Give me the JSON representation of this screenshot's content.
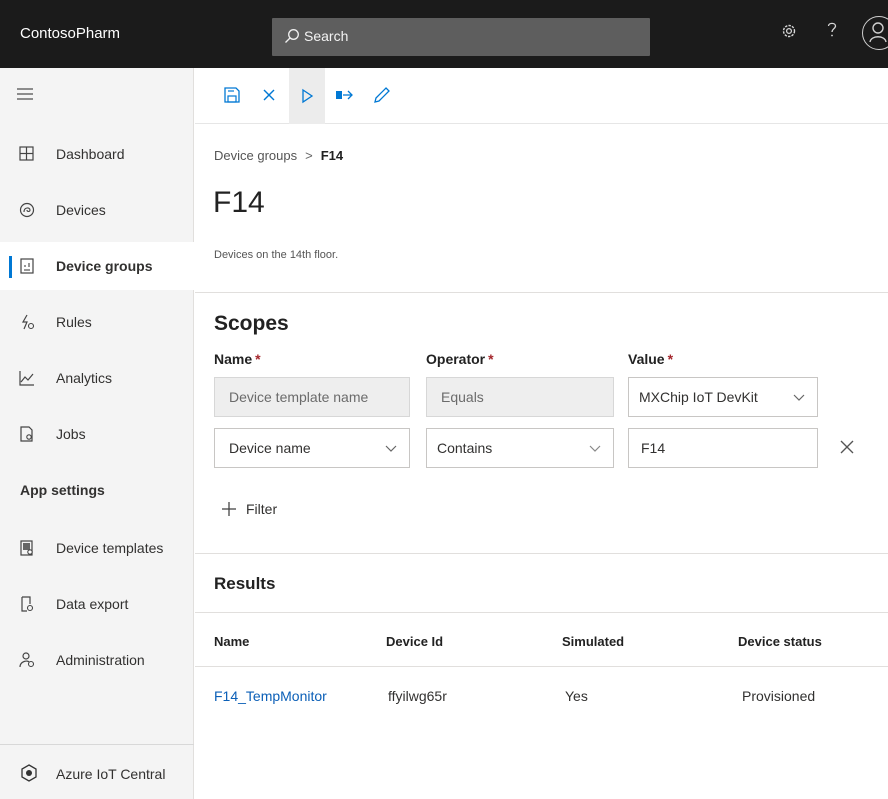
{
  "topbar": {
    "app_name": "ContosoPharm",
    "search_placeholder": "Search",
    "icons": [
      "search-icon",
      "settings-icon",
      "help-icon",
      "account-icon"
    ]
  },
  "sidebar": {
    "items": [
      {
        "label": "Dashboard",
        "icon": "dashboard-icon",
        "active": false
      },
      {
        "label": "Devices",
        "icon": "devices-icon",
        "active": false
      },
      {
        "label": "Device groups",
        "icon": "device-groups-icon",
        "active": true
      },
      {
        "label": "Rules",
        "icon": "rules-icon",
        "active": false
      },
      {
        "label": "Analytics",
        "icon": "analytics-icon",
        "active": false
      },
      {
        "label": "Jobs",
        "icon": "jobs-icon",
        "active": false
      }
    ],
    "section_header": "App settings",
    "settings_items": [
      {
        "label": "Device templates",
        "icon": "device-templates-icon"
      },
      {
        "label": "Data export",
        "icon": "data-export-icon"
      },
      {
        "label": "Administration",
        "icon": "administration-icon"
      }
    ],
    "footer_label": "Azure IoT Central"
  },
  "toolbar": {
    "tools": [
      "save-icon",
      "close-icon",
      "run-icon",
      "export-icon",
      "edit-icon"
    ]
  },
  "breadcrumb": {
    "parent": "Device groups",
    "separator": ">",
    "current": "F14"
  },
  "page": {
    "title": "F14",
    "description": "Devices on the 14th floor."
  },
  "scopes": {
    "title": "Scopes",
    "columns": {
      "name": "Name",
      "operator": "Operator",
      "value": "Value",
      "required_mark": "*"
    },
    "rows": [
      {
        "name": "Device template name",
        "operator": "Equals",
        "value": "MXChip IoT DevKit"
      },
      {
        "name": "Device name",
        "operator": "Contains",
        "value": "F14"
      }
    ],
    "filter_label": "Filter"
  },
  "results": {
    "title": "Results",
    "headers": [
      "Name",
      "Device Id",
      "Simulated",
      "Device status"
    ],
    "rows": [
      {
        "name": "F14_TempMonitor",
        "device_id": "ffyilwg65r",
        "simulated": "Yes",
        "status": "Provisioned"
      }
    ]
  },
  "colors": {
    "topbar_bg": "#1b1b1b",
    "accent": "#0078d4",
    "link": "#0b5fb7",
    "required": "#a4262c"
  }
}
